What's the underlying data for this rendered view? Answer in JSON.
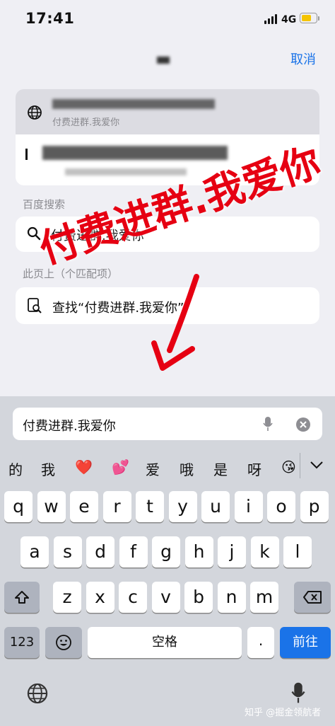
{
  "status": {
    "time": "17:41",
    "network": "4G"
  },
  "header": {
    "cancel_label": "取消"
  },
  "results": {
    "top_sub": "付费进群.我爱你",
    "section_baidu": "百度搜索",
    "baidu_query": "付费进群.我爱你",
    "section_this": "此页上（个匹配项）",
    "find_label": "查找“付费进群.我爱你”"
  },
  "overlay": {
    "red_text": "付费进群.我爱你"
  },
  "keyboard": {
    "input_value": "付费进群.我爱你",
    "candidates": [
      "的",
      "我",
      "❤️",
      "💕",
      "爱",
      "哦",
      "是",
      "呀",
      "😘"
    ],
    "row1": [
      "q",
      "w",
      "e",
      "r",
      "t",
      "y",
      "u",
      "i",
      "o",
      "p"
    ],
    "row2": [
      "a",
      "s",
      "d",
      "f",
      "g",
      "h",
      "j",
      "k",
      "l"
    ],
    "row3": [
      "z",
      "x",
      "c",
      "v",
      "b",
      "n",
      "m"
    ],
    "num_label": "123",
    "space_label": "空格",
    "go_label": "前往"
  },
  "watermark": "知乎 @掘金领航者",
  "colors": {
    "accent": "#1a73e8",
    "overlay_red": "#e60012",
    "battery": "#f5c400"
  }
}
